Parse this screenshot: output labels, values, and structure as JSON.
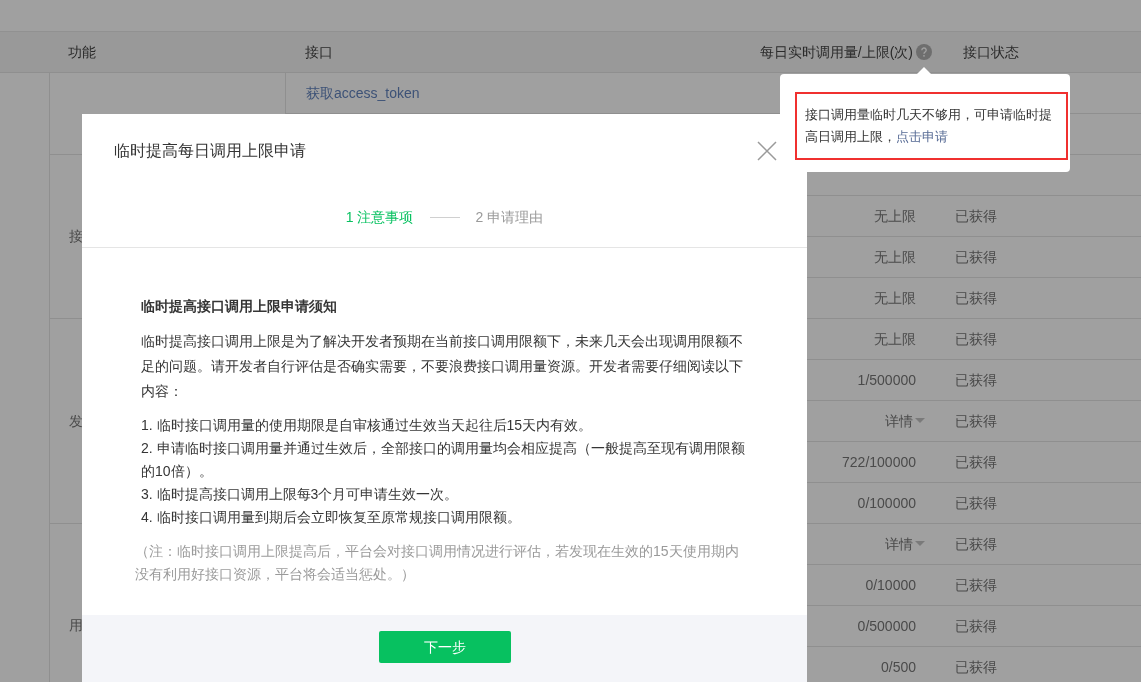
{
  "table": {
    "columns": [
      "功能",
      "接口",
      "每日实时调用量/上限(次)",
      "接口状态"
    ],
    "groups": [
      {
        "rows": [
          {
            "interface": "获取access_token"
          },
          {}
        ]
      },
      {
        "label": "接",
        "rows": [
          {},
          {
            "quota": "无上限",
            "kind": "text",
            "status": "已获得"
          },
          {
            "quota": "无上限",
            "kind": "text",
            "status": "已获得"
          },
          {
            "quota": "无上限",
            "kind": "text",
            "status": "已获得"
          }
        ]
      },
      {
        "label": "发",
        "rows": [
          {
            "quota": "无上限",
            "kind": "text",
            "status": "已获得"
          },
          {
            "quota": "1/500000",
            "kind": "text",
            "status": "已获得"
          },
          {
            "quota": "详情",
            "kind": "dropdown",
            "status": "已获得"
          },
          {
            "quota": "722/100000",
            "kind": "text",
            "status": "已获得"
          },
          {
            "quota": "0/100000",
            "kind": "text",
            "status": "已获得"
          }
        ]
      },
      {
        "label": "用",
        "rows": [
          {
            "quota": "详情",
            "kind": "dropdown",
            "status": "已获得"
          },
          {
            "quota": "0/10000",
            "kind": "text",
            "status": "已获得"
          },
          {
            "quota": "0/500000",
            "kind": "text",
            "status": "已获得"
          },
          {
            "quota": "0/500",
            "kind": "text",
            "status": "已获得"
          }
        ]
      }
    ]
  },
  "popover": {
    "text": "接口调用量临时几天不够用，可申请临时提高日调用上限，",
    "link": "点击申请"
  },
  "modal": {
    "title": "临时提高每日调用上限申请",
    "steps": [
      {
        "label": "1 注意事项",
        "selected": true
      },
      {
        "label": "2 申请理由",
        "selected": false
      }
    ],
    "heading": "临时提高接口调用上限申请须知",
    "intro": "临时提高接口调用上限是为了解决开发者预期在当前接口调用限额下，未来几天会出现调用限额不足的问题。请开发者自行评估是否确实需要，不要浪费接口调用量资源。开发者需要仔细阅读以下内容：",
    "items": [
      "1. 临时接口调用量的使用期限是自审核通过生效当天起往后15天内有效。",
      "2. 申请临时接口调用量并通过生效后，全部接口的调用量均会相应提高（一般提高至现有调用限额的10倍）。",
      "3. 临时提高接口调用上限每3个月可申请生效一次。",
      "4. 临时接口调用量到期后会立即恢复至原常规接口调用限额。"
    ],
    "note": "（注：临时接口调用上限提高后，平台会对接口调用情况进行评估，若发现在生效的15天使用期内没有利用好接口资源，平台将会适当惩处。）",
    "button": "下一步"
  }
}
